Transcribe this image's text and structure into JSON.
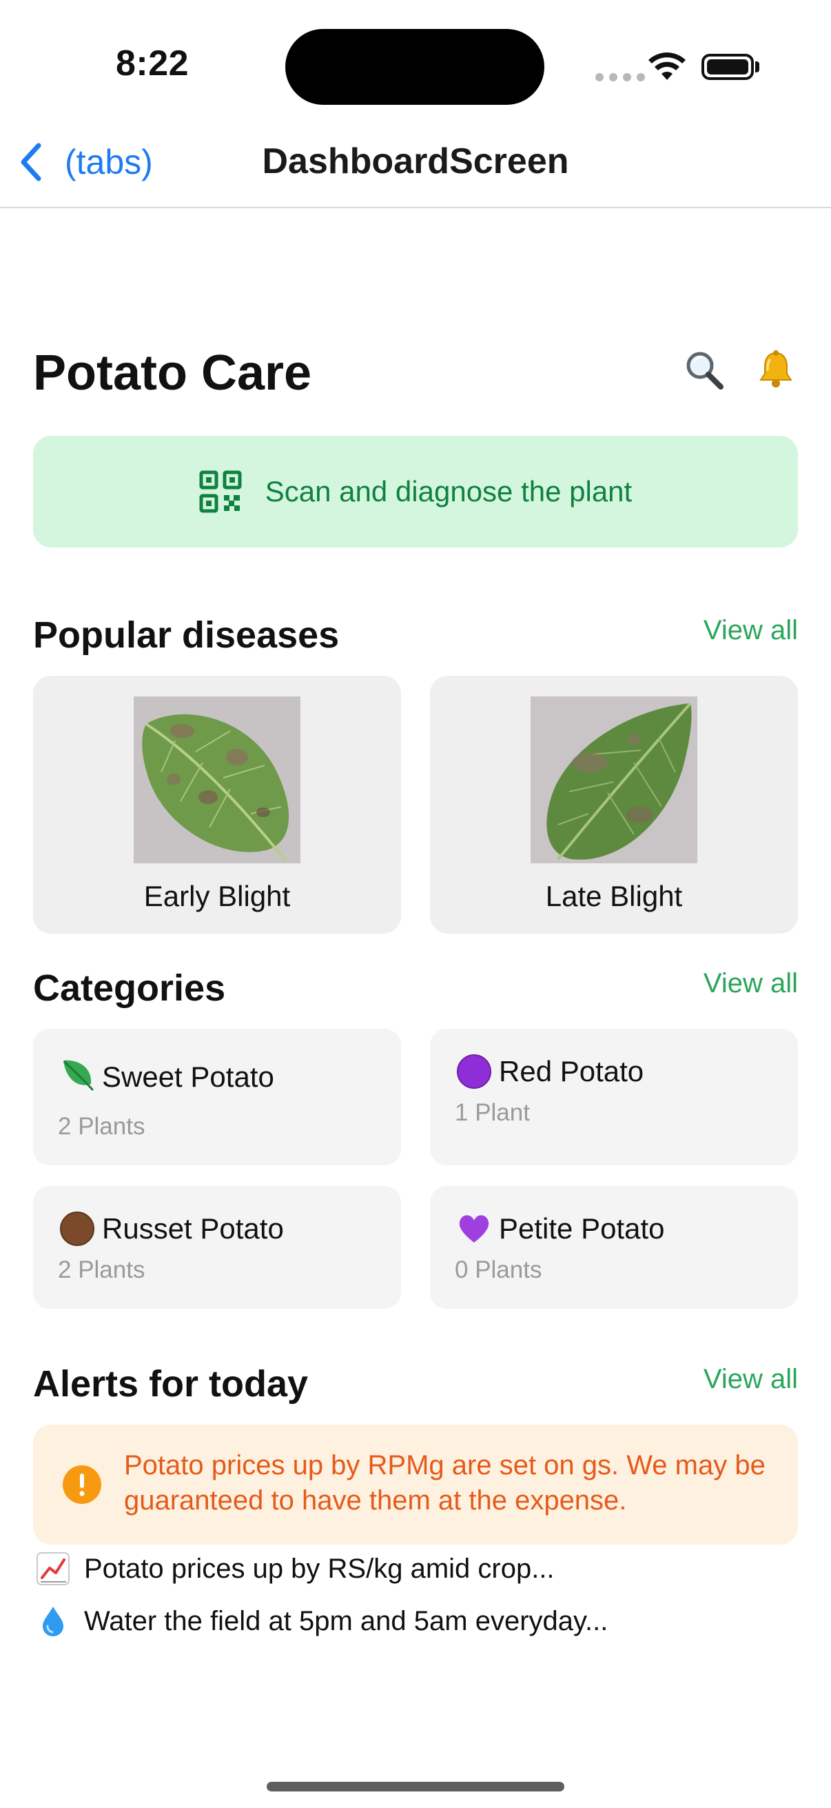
{
  "status_bar": {
    "time": "8:22"
  },
  "nav": {
    "back_label": "(tabs)",
    "title": "DashboardScreen"
  },
  "header": {
    "title": "Potato Care",
    "icons": [
      "search-icon",
      "bell-icon"
    ]
  },
  "scan": {
    "label": "Scan and diagnose the plant",
    "icon": "qr-code-icon"
  },
  "popular_diseases": {
    "title": "Popular diseases",
    "view_all": "View all",
    "items": [
      {
        "label": "Early Blight"
      },
      {
        "label": "Late Blight"
      }
    ]
  },
  "categories": {
    "title": "Categories",
    "view_all": "View all",
    "items": [
      {
        "name": "Sweet Potato",
        "count": "2 Plants",
        "icon": "leaf-icon"
      },
      {
        "name": "Red Potato",
        "count": "1 Plant",
        "icon": "purple-circle-icon"
      },
      {
        "name": "Russet Potato",
        "count": "2 Plants",
        "icon": "brown-circle-icon"
      },
      {
        "name": "Petite Potato",
        "count": "0 Plants",
        "icon": "purple-heart-icon"
      }
    ]
  },
  "alerts": {
    "title": "Alerts for today",
    "view_all": "View all",
    "highlight": "Potato prices up by RPMg are set on gs. We may be guaranteed to have them at the expense.",
    "items": [
      {
        "text": "Potato prices up by RS/kg amid crop...",
        "icon": "chart-increasing-icon"
      },
      {
        "text": "Water the field at 5pm and 5am everyday...",
        "icon": "droplet-icon"
      }
    ]
  },
  "colors": {
    "accent_blue": "#1e7bf0",
    "green_text": "#0f8140",
    "green_bg": "#d4f6de",
    "view_all_green": "#2aa65a",
    "alert_orange": "#e45b1b",
    "alert_bg": "#fff1df"
  }
}
